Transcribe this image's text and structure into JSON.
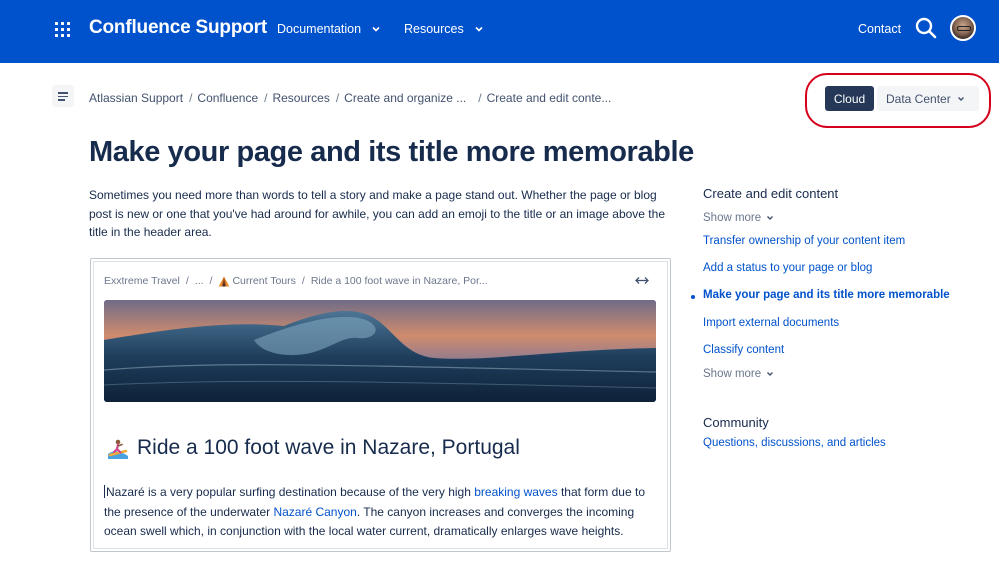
{
  "topnav": {
    "brand": "Confluence Support",
    "items": [
      {
        "label": "Documentation"
      },
      {
        "label": "Resources"
      }
    ],
    "contact": "Contact"
  },
  "breadcrumb": [
    "Atlassian Support",
    "Confluence",
    "Resources",
    "Create and organize ...",
    "Create and edit conte..."
  ],
  "deployment": {
    "selected": "Cloud",
    "other": "Data Center"
  },
  "main": {
    "title": "Make your page and its title more memorable",
    "intro": "Sometimes you need more than words to tell a story and make a page stand out. Whether the page or blog post is new or one that you've had around for awhile, you can add an emoji to the title or an image above the title in the header area."
  },
  "example": {
    "crumbs": [
      "Exxtreme Travel",
      "...",
      "Current Tours",
      "Ride a 100 foot wave in Nazare, Por..."
    ],
    "title": "Ride a 100 foot wave in Nazare, Portugal",
    "body": {
      "p1": "Nazaré is a very popular surfing destination because of the very high ",
      "link1": "breaking waves",
      "p2": " that form due to the presence of the underwater ",
      "link2": "Nazaré Canyon",
      "p3": ". The canyon increases and converges the incoming ocean swell which, in conjunction with the local water current, dramatically enlarges wave heights."
    }
  },
  "sidebar": {
    "section_title": "Create and edit content",
    "show_more": "Show more",
    "links": [
      {
        "label": "Transfer ownership of your content item",
        "active": false
      },
      {
        "label": "Add a status to your page or blog",
        "active": false
      },
      {
        "label": "Make your page and its title more memorable",
        "active": true
      },
      {
        "label": "Import external documents",
        "active": false
      },
      {
        "label": "Classify content",
        "active": false
      }
    ],
    "show_more_2": "Show more",
    "community_title": "Community",
    "community_link": "Questions, discussions, and articles"
  },
  "colors": {
    "brand_blue": "#0052cc",
    "toggle_dark": "#253858",
    "highlight_red": "#d6001c"
  }
}
